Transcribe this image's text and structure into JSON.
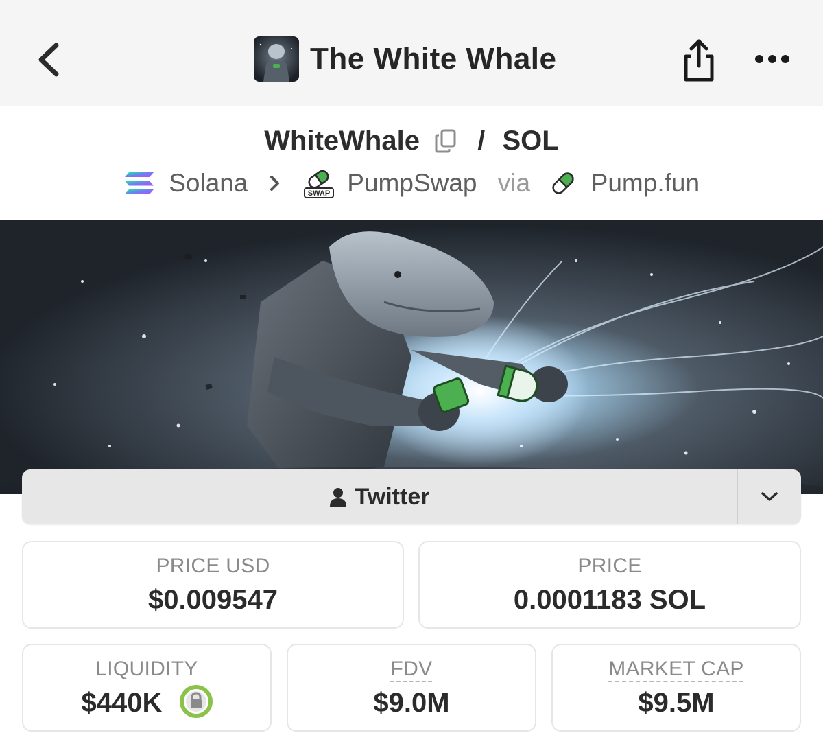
{
  "header": {
    "title": "The White Whale",
    "back_icon": "chevron-left-icon",
    "share_icon": "share-icon",
    "more_icon": "more-horizontal-icon"
  },
  "pair": {
    "base": "WhiteWhale",
    "separator": "/",
    "quote": "SOL"
  },
  "path": {
    "chain": "Solana",
    "dex": "PumpSwap",
    "via": "via",
    "launchpad": "Pump.fun",
    "swap_badge_text": "SWAP"
  },
  "social": {
    "twitter_label": "Twitter"
  },
  "stats": {
    "price_usd": {
      "label": "PRICE USD",
      "value": "$0.009547"
    },
    "price": {
      "label": "PRICE",
      "value": "0.0001183 SOL"
    },
    "liquidity": {
      "label": "LIQUIDITY",
      "value": "$440K"
    },
    "fdv": {
      "label": "FDV",
      "value": "$9.0M"
    },
    "market_cap": {
      "label": "MARKET CAP",
      "value": "$9.5M"
    }
  },
  "colors": {
    "topbar_bg": "#f5f5f5",
    "text_dark": "#2b2b2b",
    "text_muted": "#8a8a8a",
    "pill_green": "#4caf50",
    "lock_green": "#8bc34a"
  }
}
